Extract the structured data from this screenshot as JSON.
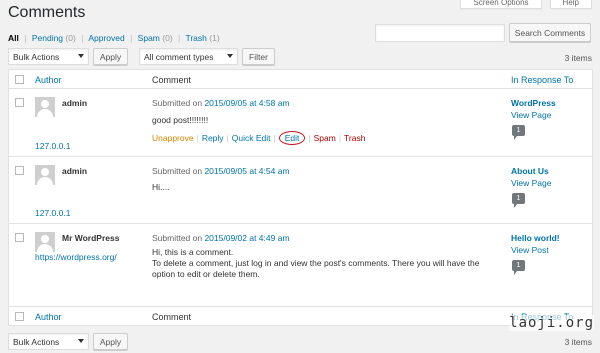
{
  "header": {
    "title": "Comments",
    "screen_options": "Screen Options",
    "help": "Help"
  },
  "filters": [
    {
      "label": "All",
      "count": ""
    },
    {
      "label": "Pending",
      "count": "(0)"
    },
    {
      "label": "Approved",
      "count": ""
    },
    {
      "label": "Spam",
      "count": "(0)"
    },
    {
      "label": "Trash",
      "count": "(1)"
    }
  ],
  "search": {
    "button_label": "Search Comments",
    "value": ""
  },
  "toolbar": {
    "bulk_actions": "Bulk Actions",
    "apply": "Apply",
    "comment_types": "All comment types",
    "filter": "Filter",
    "items_count": "3 items"
  },
  "table": {
    "col_author": "Author",
    "col_comment": "Comment",
    "col_response": "In Response To",
    "rows": [
      {
        "author": "admin",
        "author_url": "",
        "ip": "127.0.0.1",
        "submitted_prefix": "Submitted on ",
        "date": "2015/09/05 at 4:58 am",
        "text": [
          "good post!!!!!!!!"
        ],
        "actions": {
          "unapprove": "Unapprove",
          "reply": "Reply",
          "quick_edit": "Quick Edit",
          "edit": "Edit",
          "spam": "Spam",
          "trash": "Trash"
        },
        "post": "WordPress",
        "view": "View Page",
        "comments_count": "1"
      },
      {
        "author": "admin",
        "author_url": "",
        "ip": "127.0.0.1",
        "submitted_prefix": "Submitted on ",
        "date": "2015/09/05 at 4:54 am",
        "text": [
          "Hi...."
        ],
        "post": "About Us",
        "view": "View Page",
        "comments_count": "1"
      },
      {
        "author": "Mr WordPress",
        "author_url": "https://wordpress.org/",
        "ip": "",
        "submitted_prefix": "Submitted on ",
        "date": "2015/09/02 at 4:49 am",
        "text": [
          "Hi, this is a comment.",
          "To delete a comment, just log in and view the post's comments. There you will have the option to edit or delete them."
        ],
        "post": "Hello world!",
        "view": "View Post",
        "comments_count": "1"
      }
    ]
  },
  "watermark": "laoji.org"
}
